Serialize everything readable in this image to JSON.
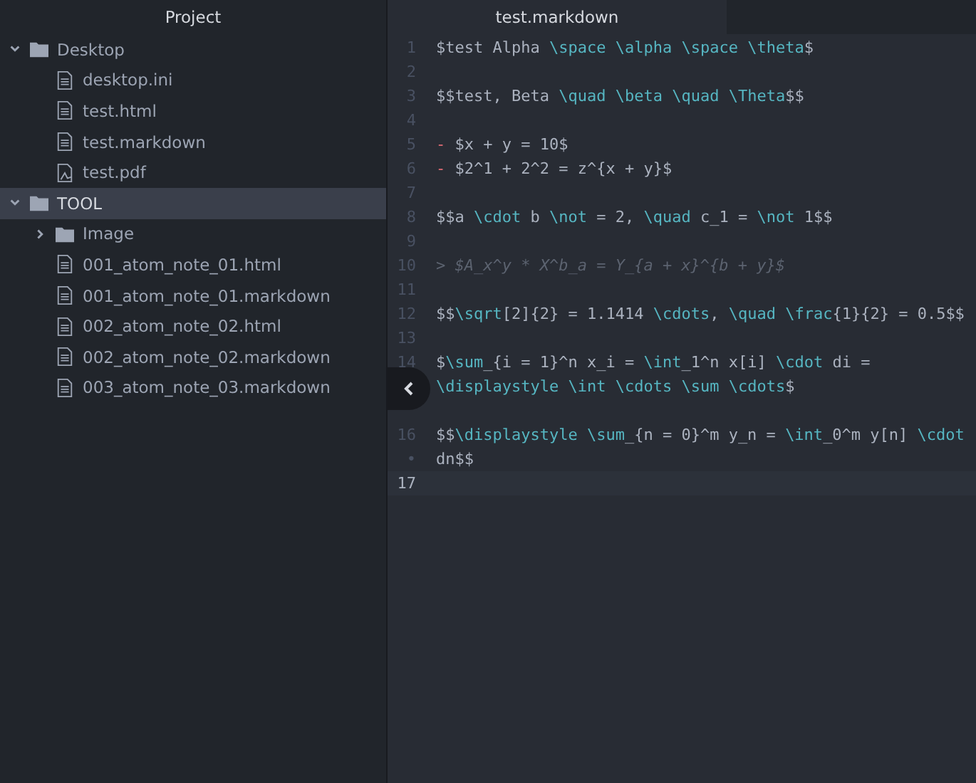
{
  "sidebar": {
    "title": "Project",
    "tree": [
      {
        "label": "Desktop",
        "kind": "folder",
        "expanded": true,
        "selected": false,
        "children": [
          {
            "label": "desktop.ini",
            "kind": "file"
          },
          {
            "label": "test.html",
            "kind": "file"
          },
          {
            "label": "test.markdown",
            "kind": "file"
          },
          {
            "label": "test.pdf",
            "kind": "pdf"
          }
        ]
      },
      {
        "label": "TOOL",
        "kind": "folder",
        "expanded": true,
        "selected": true,
        "children": [
          {
            "label": "Image",
            "kind": "folder",
            "expanded": false,
            "selected": false
          },
          {
            "label": "001_atom_note_01.html",
            "kind": "file"
          },
          {
            "label": "001_atom_note_01.markdown",
            "kind": "file"
          },
          {
            "label": "002_atom_note_02.html",
            "kind": "file"
          },
          {
            "label": "002_atom_note_02.markdown",
            "kind": "file"
          },
          {
            "label": "003_atom_note_03.markdown",
            "kind": "file"
          }
        ]
      }
    ]
  },
  "tabs": [
    {
      "label": "test.markdown",
      "selected": true
    }
  ],
  "editor": {
    "lines": [
      {
        "number": "1",
        "tokens": [
          {
            "kind": "text",
            "text": "$test Alpha "
          },
          {
            "kind": "command",
            "text": "\\space"
          },
          {
            "kind": "command",
            "text": " \\alpha"
          },
          {
            "kind": "command",
            "text": " \\space"
          },
          {
            "kind": "command",
            "text": " \\theta"
          },
          {
            "kind": "text",
            "text": "$"
          }
        ]
      },
      {
        "number": "2"
      },
      {
        "number": "3",
        "tokens": [
          {
            "kind": "text",
            "text": "$$test, Beta "
          },
          {
            "kind": "command",
            "text": "\\quad"
          },
          {
            "kind": "command",
            "text": " \\beta"
          },
          {
            "kind": "command",
            "text": " \\quad"
          },
          {
            "kind": "command",
            "text": " \\Theta"
          },
          {
            "kind": "text",
            "text": "$$"
          }
        ]
      },
      {
        "number": "4"
      },
      {
        "number": "5",
        "tokens": [
          {
            "kind": "bullet",
            "text": "-"
          },
          {
            "kind": "text",
            "text": " $x + y = 10$"
          }
        ]
      },
      {
        "number": "6",
        "tokens": [
          {
            "kind": "bullet",
            "text": "-"
          },
          {
            "kind": "text",
            "text": " $2^1 + 2^2 = z^{x + y}$"
          }
        ]
      },
      {
        "number": "7"
      },
      {
        "number": "8",
        "tokens": [
          {
            "kind": "text",
            "text": "$$a "
          },
          {
            "kind": "command",
            "text": "\\cdot"
          },
          {
            "kind": "text",
            "text": " b "
          },
          {
            "kind": "command",
            "text": "\\not"
          },
          {
            "kind": "text",
            "text": " = 2, "
          },
          {
            "kind": "command",
            "text": "\\quad"
          },
          {
            "kind": "text",
            "text": " c_1 = "
          },
          {
            "kind": "command",
            "text": "\\not"
          },
          {
            "kind": "text",
            "text": " 1$$"
          }
        ]
      },
      {
        "number": "9"
      },
      {
        "number": "10",
        "tokens": [
          {
            "kind": "quote",
            "text": "> $A_x^y * X^b_a = Y_{a + x}^{b + y}$"
          }
        ]
      },
      {
        "number": "11"
      },
      {
        "number": "12",
        "tokens": [
          {
            "kind": "text",
            "text": "$$"
          },
          {
            "kind": "command",
            "text": "\\sqrt"
          },
          {
            "kind": "text",
            "text": "[2]{2} = 1.1414 "
          },
          {
            "kind": "command",
            "text": "\\cdots"
          },
          {
            "kind": "text",
            "text": ", "
          },
          {
            "kind": "command",
            "text": "\\quad"
          },
          {
            "kind": "command",
            "text": " \\frac"
          },
          {
            "kind": "text",
            "text": "{1}{2} = 0.5$$"
          }
        ]
      },
      {
        "number": "13"
      },
      {
        "number": "14",
        "tokens": [
          {
            "kind": "text",
            "text": "$"
          },
          {
            "kind": "command",
            "text": "\\sum"
          },
          {
            "kind": "text",
            "text": "_{i = 1}^n x_i = "
          },
          {
            "kind": "command",
            "text": "\\int"
          },
          {
            "kind": "text",
            "text": "_1^n x[i] "
          },
          {
            "kind": "command",
            "text": "\\cdot"
          },
          {
            "kind": "text",
            "text": " di ="
          }
        ]
      },
      {
        "tokens": [
          {
            "kind": "command",
            "text": "\\displaystyle"
          },
          {
            "kind": "command",
            "text": " \\int"
          },
          {
            "kind": "command",
            "text": " \\cdots"
          },
          {
            "kind": "command",
            "text": " \\sum"
          },
          {
            "kind": "command",
            "text": " \\cdots"
          },
          {
            "kind": "text",
            "text": "$"
          }
        ]
      },
      {
        "kind": "sidebar-toggle"
      },
      {
        "number": "16",
        "tokens": [
          {
            "kind": "text",
            "text": "$$"
          },
          {
            "kind": "command",
            "text": "\\displaystyle"
          },
          {
            "kind": "command",
            "text": " \\sum"
          },
          {
            "kind": "text",
            "text": "_{n = 0}^m y_n = "
          },
          {
            "kind": "command",
            "text": "\\int"
          },
          {
            "kind": "text",
            "text": "_0^m y[n] "
          },
          {
            "kind": "command",
            "text": "\\cdot"
          }
        ]
      },
      {
        "number": "•",
        "tokens": [
          {
            "kind": "text",
            "text": "dn$$"
          }
        ]
      },
      {
        "number": "17",
        "current": true
      }
    ]
  }
}
